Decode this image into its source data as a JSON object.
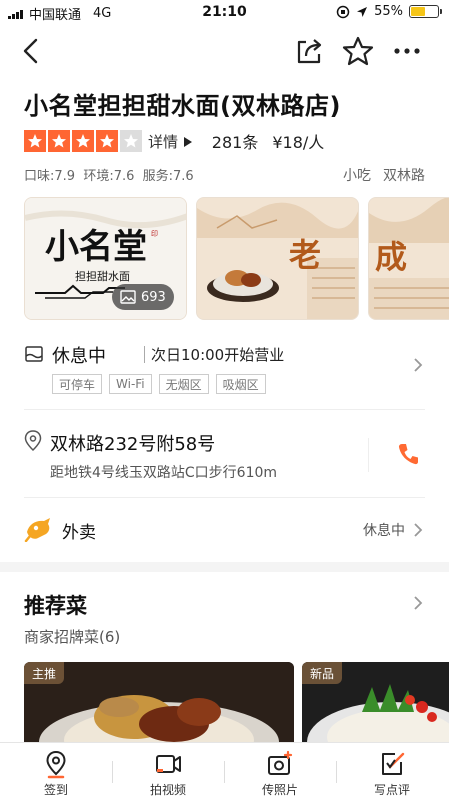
{
  "status_bar": {
    "carrier": "中国联通",
    "network": "4G",
    "time": "21:10",
    "battery": "55%",
    "battery_level": 0.55
  },
  "nav": {
    "back_icon": "back-arrow-icon",
    "share_icon": "share-icon",
    "favorite_icon": "star-outline-icon",
    "more_icon": "more-icon"
  },
  "shop": {
    "name": "小名堂担担甜水面(双林路店)",
    "star_rating": 4,
    "star_max": 5,
    "detail_link": "详情",
    "review_count": "281条",
    "price_per_person": "¥18/人",
    "scores": "口味:7.9  环境:7.6  服务:7.6",
    "category": "小吃",
    "area": "双林路"
  },
  "gallery": {
    "photo_count": "693",
    "card1_logo": "小名堂",
    "card1_sub": "担担甜水面",
    "card2_text": "老",
    "card3_text": "成"
  },
  "business": {
    "status": "休息中",
    "open_time": "次日10:00开始营业",
    "facilities": [
      "可停车",
      "Wi-Fi",
      "无烟区",
      "吸烟区"
    ]
  },
  "address": {
    "text": "双林路232号附58号",
    "subway": "距地铁4号线玉双路站C口步行610m"
  },
  "takeout": {
    "label": "外卖",
    "status": "休息中"
  },
  "recommend": {
    "title": "推荐菜",
    "subtitle": "商家招牌菜(6)",
    "dish1_badge": "主推",
    "dish2_badge": "新品"
  },
  "tabbar": {
    "items": [
      {
        "label": "签到",
        "icon": "location-pin-icon"
      },
      {
        "label": "拍视频",
        "icon": "video-camera-icon"
      },
      {
        "label": "传照片",
        "icon": "photo-upload-icon"
      },
      {
        "label": "写点评",
        "icon": "write-review-icon"
      }
    ]
  },
  "colors": {
    "accent": "#ff6633",
    "phone": "#ff6a33",
    "takeout_icon": "#f5a623"
  }
}
